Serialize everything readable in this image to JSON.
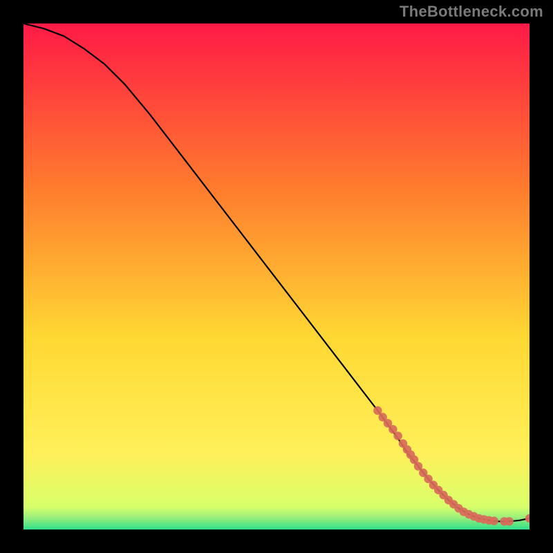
{
  "watermark": "TheBottleneck.com",
  "colors": {
    "background": "#000000",
    "gradient_top": "#ff1a46",
    "gradient_mid1": "#ff7a2e",
    "gradient_mid2": "#ffd833",
    "gradient_mid3": "#fff05a",
    "gradient_bottom": "#2fe08a",
    "curve": "#000000",
    "marker": "#d86a5a",
    "watermark_text": "#7a7a7a"
  },
  "chart_data": {
    "type": "line",
    "title": "",
    "xlabel": "",
    "ylabel": "",
    "xlim": [
      0,
      100
    ],
    "ylim": [
      0,
      100
    ],
    "series": [
      {
        "name": "curve",
        "x": [
          0,
          4,
          8,
          12,
          16,
          20,
          25,
          30,
          35,
          40,
          45,
          50,
          55,
          60,
          65,
          70,
          74,
          76,
          78,
          80,
          82,
          84,
          86,
          88,
          90,
          92,
          94,
          96,
          98,
          100
        ],
        "y": [
          100,
          99,
          97.5,
          95,
          92,
          88,
          82,
          75.5,
          69,
          62.5,
          56,
          49.5,
          43,
          36.5,
          30,
          23.5,
          18,
          15,
          12.5,
          10,
          7.8,
          5.8,
          4.2,
          3.0,
          2.2,
          1.8,
          1.6,
          1.6,
          1.8,
          2.2
        ]
      },
      {
        "name": "markers",
        "x": [
          70,
          71,
          72,
          73,
          74,
          75,
          75.8,
          76.5,
          77.2,
          78,
          79,
          80,
          81,
          82,
          83,
          84,
          85,
          86,
          87,
          88,
          89,
          90,
          91,
          92,
          93,
          95,
          96,
          100
        ],
        "y": [
          23.5,
          22.2,
          21.0,
          19.8,
          18.5,
          17.0,
          15.8,
          14.8,
          13.8,
          12.5,
          11.2,
          10.0,
          8.8,
          7.8,
          6.8,
          5.8,
          5.0,
          4.2,
          3.5,
          3.0,
          2.6,
          2.2,
          2.0,
          1.8,
          1.7,
          1.6,
          1.6,
          2.2
        ]
      }
    ]
  }
}
